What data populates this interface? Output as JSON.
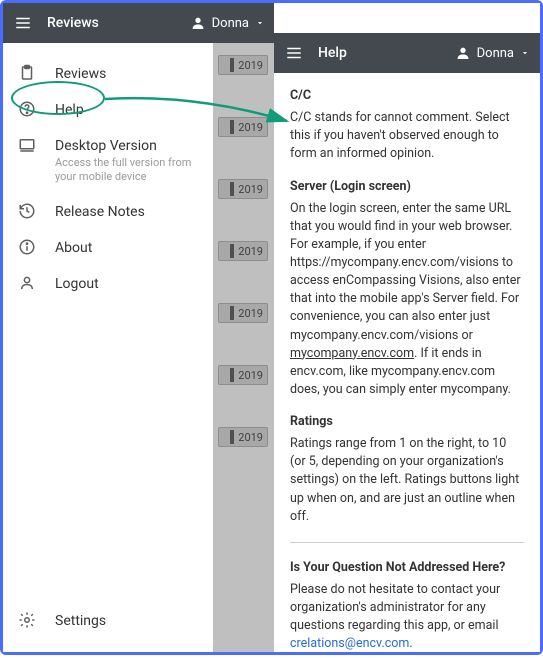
{
  "left": {
    "appbar": {
      "title": "Reviews",
      "user": "Donna"
    },
    "menu": [
      {
        "id": "reviews",
        "label": "Reviews",
        "icon": "clipboard-icon"
      },
      {
        "id": "help",
        "label": "Help",
        "icon": "help-circle-icon"
      },
      {
        "id": "desktop",
        "label": "Desktop Version",
        "sub": "Access the full version from your mobile device",
        "icon": "desktop-icon"
      },
      {
        "id": "release",
        "label": "Release Notes",
        "icon": "history-icon"
      },
      {
        "id": "about",
        "label": "About",
        "icon": "info-icon"
      },
      {
        "id": "logout",
        "label": "Logout",
        "icon": "person-icon"
      }
    ],
    "settings": {
      "label": "Settings",
      "icon": "gear-icon"
    },
    "bg_year": "2019",
    "annotation": {
      "accent": "#109b7a",
      "arrow_from": "help-menu-item",
      "arrow_to": "help-article-cc"
    }
  },
  "right": {
    "appbar": {
      "title": "Help",
      "user": "Donna"
    },
    "sections": {
      "cc": {
        "heading": "C/C",
        "body": "C/C stands for cannot comment. Select this if you haven't observed enough to form an informed opinion."
      },
      "server": {
        "heading": "Server (Login screen)",
        "body_1": "On the login screen, enter the same URL that you would find in your web browser.  For example, if you enter https://mycompany.encv.com/visions to access enCompassing Visions, also enter that into the mobile app's Server field.  For convenience, you can also enter just mycompany.encv.com/visions or ",
        "link_text": "mycompany.encv.com",
        "body_2": ". If it ends in encv.com, like mycompany.encv.com does, you can simply enter mycompany."
      },
      "ratings": {
        "heading": "Ratings",
        "body": "Ratings range from 1 on the right, to 10 (or 5, depending on your organization's settings) on the left. Ratings buttons light up when on, and are just an outline when off."
      },
      "contact": {
        "heading": "Is Your Question Not Addressed Here?",
        "body": "Please do not hesitate to contact your organization's administrator for any questions regarding this app, or email ",
        "email": "crelations@encv.com",
        "tail": "."
      }
    }
  }
}
